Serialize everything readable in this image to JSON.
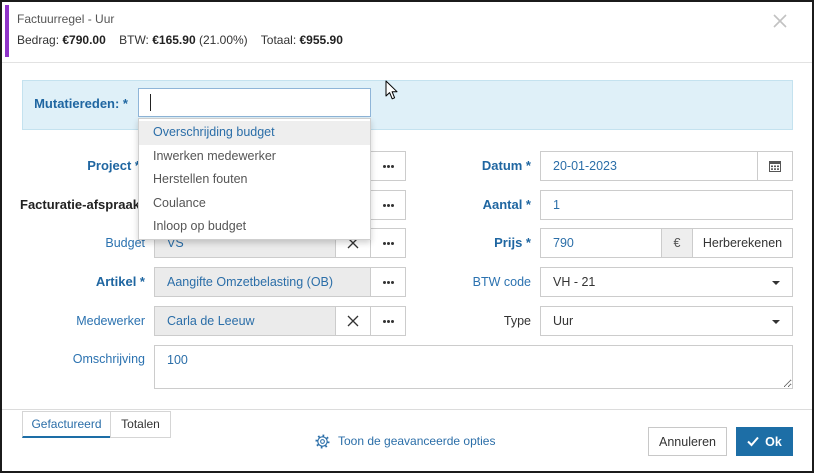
{
  "theme": {
    "accent": "#1d6ea6",
    "label_blue": "#1f66a1",
    "link_blue": "#2b72b0",
    "value_blue": "#2b6ea8",
    "purple": "#8e33c8",
    "panel_bg": "#dff0f8",
    "field_gray": "#ebebeb"
  },
  "header": {
    "title": "Factuurregel - Uur",
    "summary": {
      "bedrag_label": "Bedrag:",
      "bedrag_value": "€790.00",
      "btw_label": "BTW:",
      "btw_value": "€165.90",
      "btw_percentage": "(21.00%)",
      "totaal_label": "Totaal:",
      "totaal_value": "€955.90"
    }
  },
  "mutatiereden": {
    "label": "Mutatiereden: *",
    "value": "",
    "dropdown": {
      "options": [
        "Overschrijding budget",
        "Inwerken medewerker",
        "Herstellen fouten",
        "Coulance",
        "Inloop op budget"
      ],
      "highlighted_index": 0
    }
  },
  "form": {
    "project": {
      "label": "Project *"
    },
    "facturatie_afspraak": {
      "label": "Facturatie-afspraak"
    },
    "budget": {
      "label": "Budget",
      "value": "VS"
    },
    "artikel": {
      "label": "Artikel *",
      "value": "Aangifte Omzetbelasting (OB)"
    },
    "medewerker": {
      "label": "Medewerker",
      "value": "Carla de Leeuw"
    },
    "omschrijving": {
      "label": "Omschrijving",
      "value": "100"
    },
    "datum": {
      "label": "Datum *",
      "value": "20-01-2023"
    },
    "aantal": {
      "label": "Aantal *",
      "value": "1"
    },
    "prijs": {
      "label": "Prijs *",
      "value": "790",
      "currency_symbol": "€",
      "recalculate_label": "Herberekenen"
    },
    "btw_code": {
      "label": "BTW code",
      "value": "VH - 21"
    },
    "type": {
      "label": "Type",
      "value": "Uur"
    }
  },
  "footer": {
    "tabs": [
      {
        "label": "Gefactureerd",
        "active": true
      },
      {
        "label": "Totalen",
        "active": false
      }
    ],
    "advanced_options_label": "Toon de geavanceerde opties",
    "cancel_label": "Annuleren",
    "ok_label": "Ok"
  },
  "icons": {
    "close": "close-icon",
    "more": "ellipsis-icon",
    "clear": "clear-icon",
    "calendar": "calendar-icon",
    "dropdown": "caret-down-icon",
    "advanced": "gear-icon",
    "confirm": "check-icon",
    "pointer": "mouse-pointer-icon"
  }
}
